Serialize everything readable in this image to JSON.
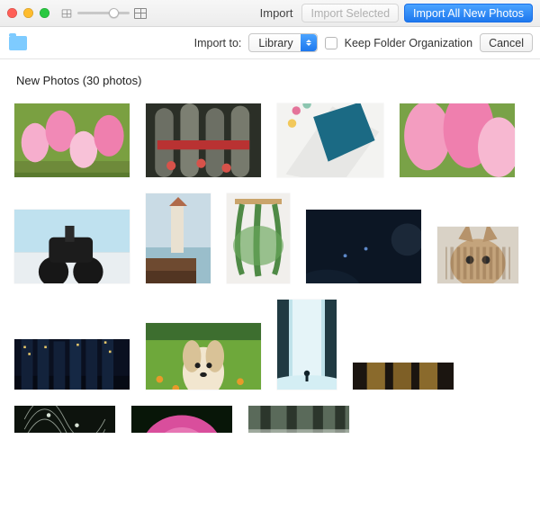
{
  "toolbar": {
    "title": "Import",
    "import_selected_label": "Import Selected",
    "import_all_label": "Import All New Photos"
  },
  "subbar": {
    "import_to_label": "Import to:",
    "import_to_value": "Library",
    "keep_folder_label": "Keep Folder Organization",
    "cancel_label": "Cancel"
  },
  "section": {
    "title": "New Photos (30 photos)"
  },
  "thumbs": [
    {
      "w": 128,
      "h": 82,
      "svg": "tulips-pink"
    },
    {
      "w": 128,
      "h": 82,
      "svg": "statues"
    },
    {
      "w": 118,
      "h": 82,
      "svg": "papers"
    },
    {
      "w": 128,
      "h": 82,
      "svg": "tulips-close"
    },
    {
      "w": 128,
      "h": 82,
      "svg": "motorcycle"
    },
    {
      "w": 72,
      "h": 100,
      "svg": "lighthouse"
    },
    {
      "w": 70,
      "h": 100,
      "svg": "hanging-plants"
    },
    {
      "w": 128,
      "h": 82,
      "svg": "night-sky"
    },
    {
      "w": 90,
      "h": 63,
      "svg": "kitten"
    },
    {
      "w": 128,
      "h": 56,
      "svg": "city-skyline"
    },
    {
      "w": 128,
      "h": 74,
      "svg": "puppy-field"
    },
    {
      "w": 66,
      "h": 100,
      "svg": "waterfall"
    },
    {
      "w": 112,
      "h": 30,
      "svg": "partial-1"
    },
    {
      "w": 112,
      "h": 30,
      "svg": "partial-2"
    },
    {
      "w": 112,
      "h": 30,
      "svg": "partial-3"
    },
    {
      "w": 112,
      "h": 30,
      "svg": "partial-4"
    }
  ],
  "colors": {
    "accent": "#1e78ee"
  }
}
